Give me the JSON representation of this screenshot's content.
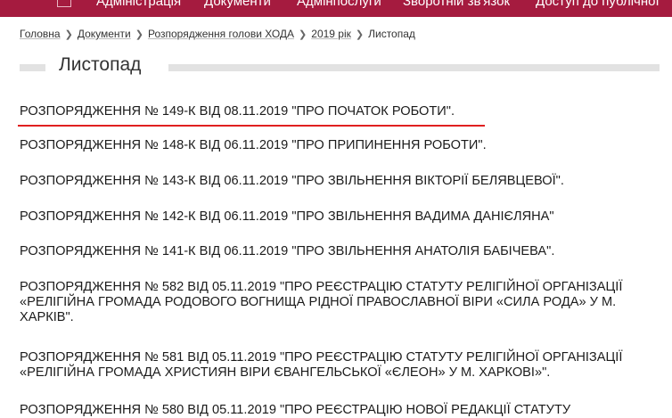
{
  "nav": {
    "items": [
      "Адміністрація",
      "Документи",
      "Адмінпослуги",
      "Зворотній зв'язок",
      "Доступ до публічної"
    ]
  },
  "breadcrumb": {
    "items": [
      "Головна",
      "Документи",
      "Розпорядження голови ХОДА",
      "2019 рік"
    ],
    "current": "Листопад"
  },
  "page": {
    "title": "Листопад"
  },
  "documents": [
    "РОЗПОРЯДЖЕННЯ № 149-К ВІД 08.11.2019 \"ПРО ПОЧАТОК РОБОТИ\".",
    "РОЗПОРЯДЖЕННЯ № 148-К ВІД 06.11.2019 \"ПРО ПРИПИНЕННЯ РОБОТИ\".",
    "РОЗПОРЯДЖЕННЯ № 143-К ВІД 06.11.2019 \"ПРО ЗВІЛЬНЕННЯ ВІКТОРІЇ БЕЛЯВЦЕВОЇ\".",
    "РОЗПОРЯДЖЕННЯ № 142-К ВІД 06.11.2019 \"ПРО ЗВІЛЬНЕННЯ ВАДИМА ДАНІЄЛЯНА\"",
    "РОЗПОРЯДЖЕННЯ № 141-К ВІД 06.11.2019 \"ПРО ЗВІЛЬНЕННЯ АНАТОЛІЯ БАБІЧЕВА\".",
    "РОЗПОРЯДЖЕННЯ № 582 ВІД 05.11.2019 \"ПРО РЕЄСТРАЦІЮ СТАТУТУ РЕЛІГІЙНОЇ ОРГАНІЗАЦІЇ «РЕЛІГІЙНА ГРОМАДА РОДОВОГО ВОГНИЩА РІДНОЇ ПРАВОСЛАВНОЇ ВІРИ «СИЛА РОДА» У М. ХАРКІВ\".",
    "РОЗПОРЯДЖЕННЯ № 581 ВІД 05.11.2019 \"ПРО РЕЄСТРАЦІЮ СТАТУТУ РЕЛІГІЙНОЇ ОРГАНІЗАЦІЇ «РЕЛІГІЙНА ГРОМАДА ХРИСТИЯН ВІРИ ЄВАНГЕЛЬСЬКОЇ «ЄЛЕОН» У М. ХАРКОВІ»\".",
    "РОЗПОРЯДЖЕННЯ № 580 ВІД 05.11.2019 \"ПРО РЕЄСТРАЦІЮ НОВОЇ РЕДАКЦІЇ СТАТУТУ"
  ],
  "colors": {
    "nav_bg": "#a51b3f",
    "active_underline": "#e02020",
    "title_bar": "#e2e2e2"
  }
}
